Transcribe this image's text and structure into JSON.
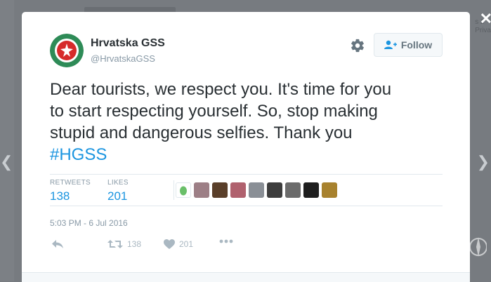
{
  "background": {
    "right_text": [
      "s 2",
      "Priva"
    ]
  },
  "tweet": {
    "author_name": "Hrvatska GSS",
    "author_handle": "@HrvatskaGSS",
    "follow_label": "Follow",
    "text_lines": [
      "Dear tourists, we respect you. It's time for you",
      "to start respecting yourself. So, stop making",
      "stupid and dangerous selfies. Thank you"
    ],
    "hashtag": "#HGSS",
    "stats": {
      "retweets_label": "RETWEETS",
      "retweets": "138",
      "likes_label": "LIKES",
      "likes": "201"
    },
    "timestamp": "5:03 PM - 6 Jul 2016",
    "actions": {
      "retweet_count": "138",
      "like_count": "201"
    }
  },
  "colors": {
    "accent": "#1b95e0",
    "text": "#292f33",
    "muted": "#8899a6"
  },
  "likers": [
    {
      "name": "liker-1",
      "color": "#e8e8e8"
    },
    {
      "name": "liker-2",
      "color": "#9d7f86"
    },
    {
      "name": "liker-3",
      "color": "#5a3f2a"
    },
    {
      "name": "liker-4",
      "color": "#b0616e"
    },
    {
      "name": "liker-5",
      "color": "#8a8f96"
    },
    {
      "name": "liker-6",
      "color": "#3d3d3d"
    },
    {
      "name": "liker-7",
      "color": "#6b6b6b"
    },
    {
      "name": "liker-8",
      "color": "#1e1e1e"
    },
    {
      "name": "liker-9",
      "color": "#a8822e"
    }
  ]
}
